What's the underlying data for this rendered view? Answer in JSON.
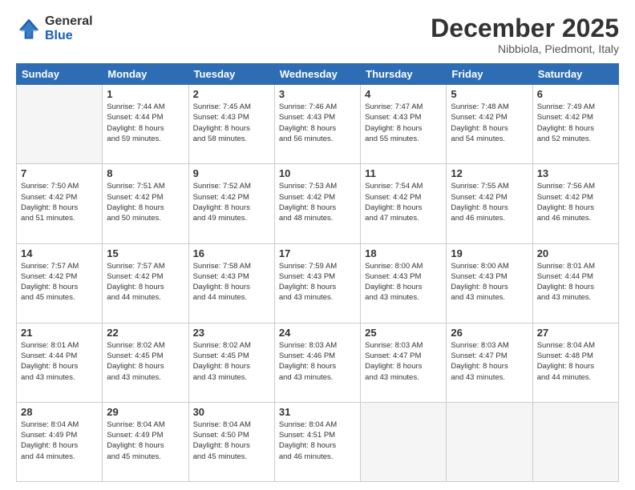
{
  "logo": {
    "general": "General",
    "blue": "Blue"
  },
  "header": {
    "month": "December 2025",
    "location": "Nibbiola, Piedmont, Italy"
  },
  "weekdays": [
    "Sunday",
    "Monday",
    "Tuesday",
    "Wednesday",
    "Thursday",
    "Friday",
    "Saturday"
  ],
  "weeks": [
    [
      {
        "day": "",
        "info": ""
      },
      {
        "day": "1",
        "info": "Sunrise: 7:44 AM\nSunset: 4:44 PM\nDaylight: 8 hours\nand 59 minutes."
      },
      {
        "day": "2",
        "info": "Sunrise: 7:45 AM\nSunset: 4:43 PM\nDaylight: 8 hours\nand 58 minutes."
      },
      {
        "day": "3",
        "info": "Sunrise: 7:46 AM\nSunset: 4:43 PM\nDaylight: 8 hours\nand 56 minutes."
      },
      {
        "day": "4",
        "info": "Sunrise: 7:47 AM\nSunset: 4:43 PM\nDaylight: 8 hours\nand 55 minutes."
      },
      {
        "day": "5",
        "info": "Sunrise: 7:48 AM\nSunset: 4:42 PM\nDaylight: 8 hours\nand 54 minutes."
      },
      {
        "day": "6",
        "info": "Sunrise: 7:49 AM\nSunset: 4:42 PM\nDaylight: 8 hours\nand 52 minutes."
      }
    ],
    [
      {
        "day": "7",
        "info": "Sunrise: 7:50 AM\nSunset: 4:42 PM\nDaylight: 8 hours\nand 51 minutes."
      },
      {
        "day": "8",
        "info": "Sunrise: 7:51 AM\nSunset: 4:42 PM\nDaylight: 8 hours\nand 50 minutes."
      },
      {
        "day": "9",
        "info": "Sunrise: 7:52 AM\nSunset: 4:42 PM\nDaylight: 8 hours\nand 49 minutes."
      },
      {
        "day": "10",
        "info": "Sunrise: 7:53 AM\nSunset: 4:42 PM\nDaylight: 8 hours\nand 48 minutes."
      },
      {
        "day": "11",
        "info": "Sunrise: 7:54 AM\nSunset: 4:42 PM\nDaylight: 8 hours\nand 47 minutes."
      },
      {
        "day": "12",
        "info": "Sunrise: 7:55 AM\nSunset: 4:42 PM\nDaylight: 8 hours\nand 46 minutes."
      },
      {
        "day": "13",
        "info": "Sunrise: 7:56 AM\nSunset: 4:42 PM\nDaylight: 8 hours\nand 46 minutes."
      }
    ],
    [
      {
        "day": "14",
        "info": "Sunrise: 7:57 AM\nSunset: 4:42 PM\nDaylight: 8 hours\nand 45 minutes."
      },
      {
        "day": "15",
        "info": "Sunrise: 7:57 AM\nSunset: 4:42 PM\nDaylight: 8 hours\nand 44 minutes."
      },
      {
        "day": "16",
        "info": "Sunrise: 7:58 AM\nSunset: 4:43 PM\nDaylight: 8 hours\nand 44 minutes."
      },
      {
        "day": "17",
        "info": "Sunrise: 7:59 AM\nSunset: 4:43 PM\nDaylight: 8 hours\nand 43 minutes."
      },
      {
        "day": "18",
        "info": "Sunrise: 8:00 AM\nSunset: 4:43 PM\nDaylight: 8 hours\nand 43 minutes."
      },
      {
        "day": "19",
        "info": "Sunrise: 8:00 AM\nSunset: 4:43 PM\nDaylight: 8 hours\nand 43 minutes."
      },
      {
        "day": "20",
        "info": "Sunrise: 8:01 AM\nSunset: 4:44 PM\nDaylight: 8 hours\nand 43 minutes."
      }
    ],
    [
      {
        "day": "21",
        "info": "Sunrise: 8:01 AM\nSunset: 4:44 PM\nDaylight: 8 hours\nand 43 minutes."
      },
      {
        "day": "22",
        "info": "Sunrise: 8:02 AM\nSunset: 4:45 PM\nDaylight: 8 hours\nand 43 minutes."
      },
      {
        "day": "23",
        "info": "Sunrise: 8:02 AM\nSunset: 4:45 PM\nDaylight: 8 hours\nand 43 minutes."
      },
      {
        "day": "24",
        "info": "Sunrise: 8:03 AM\nSunset: 4:46 PM\nDaylight: 8 hours\nand 43 minutes."
      },
      {
        "day": "25",
        "info": "Sunrise: 8:03 AM\nSunset: 4:47 PM\nDaylight: 8 hours\nand 43 minutes."
      },
      {
        "day": "26",
        "info": "Sunrise: 8:03 AM\nSunset: 4:47 PM\nDaylight: 8 hours\nand 43 minutes."
      },
      {
        "day": "27",
        "info": "Sunrise: 8:04 AM\nSunset: 4:48 PM\nDaylight: 8 hours\nand 44 minutes."
      }
    ],
    [
      {
        "day": "28",
        "info": "Sunrise: 8:04 AM\nSunset: 4:49 PM\nDaylight: 8 hours\nand 44 minutes."
      },
      {
        "day": "29",
        "info": "Sunrise: 8:04 AM\nSunset: 4:49 PM\nDaylight: 8 hours\nand 45 minutes."
      },
      {
        "day": "30",
        "info": "Sunrise: 8:04 AM\nSunset: 4:50 PM\nDaylight: 8 hours\nand 45 minutes."
      },
      {
        "day": "31",
        "info": "Sunrise: 8:04 AM\nSunset: 4:51 PM\nDaylight: 8 hours\nand 46 minutes."
      },
      {
        "day": "",
        "info": ""
      },
      {
        "day": "",
        "info": ""
      },
      {
        "day": "",
        "info": ""
      }
    ]
  ]
}
